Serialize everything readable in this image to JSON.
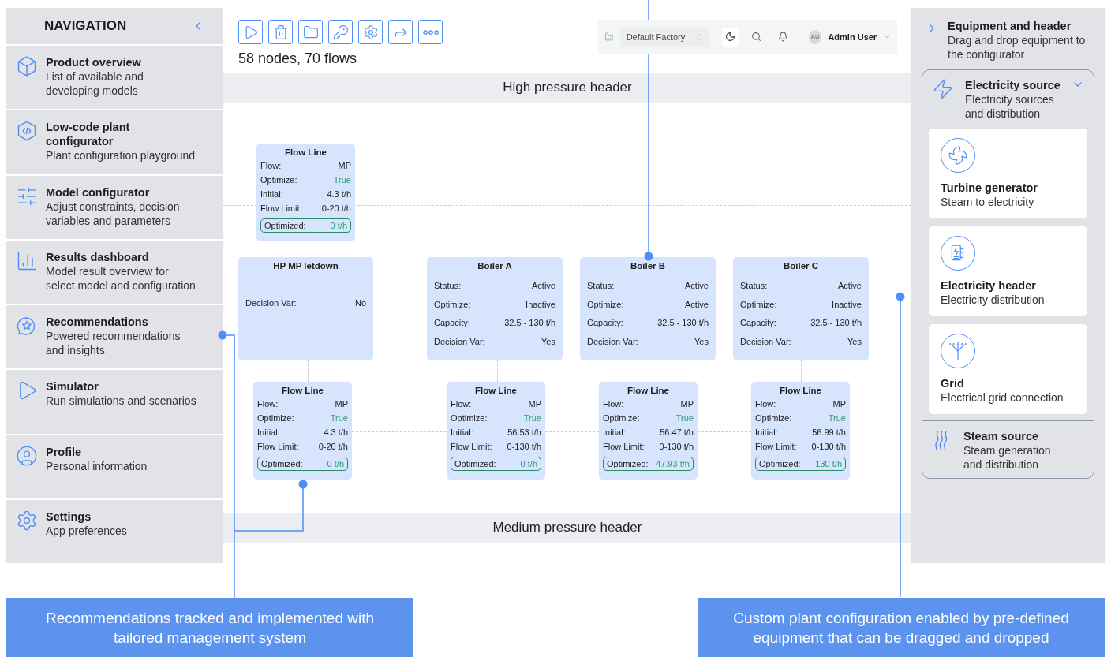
{
  "navigation": {
    "title": "NAVIGATION",
    "items": [
      {
        "title": "Product overview",
        "description": "List of available and developing models"
      },
      {
        "title": "Low-code plant configurator",
        "description": "Plant configuration playground"
      },
      {
        "title": "Model configurator",
        "description": "Adjust constraints, decision variables and parameters"
      },
      {
        "title": "Results dashboard",
        "description": "Model result overview for select model and configuration"
      },
      {
        "title": "Recommendations",
        "description": "Powered recommendations and insights"
      },
      {
        "title": "Simulator",
        "description": "Run simulations and scenarios"
      },
      {
        "title": "Profile",
        "description": "Personal information"
      },
      {
        "title": "Settings",
        "description": "App preferences"
      }
    ]
  },
  "toolbar": {
    "summary": "58 nodes, 70 flows"
  },
  "app_header": {
    "factory": "Default Factory",
    "avatar": "AU",
    "user": "Admin User"
  },
  "canvas": {
    "headers": [
      "High pressure header",
      "Medium pressure header"
    ],
    "nodes": [
      {
        "kind": "flow_line",
        "title": "Flow Line",
        "fields": [
          {
            "label": "Flow:",
            "value": "MP",
            "accent": false
          },
          {
            "label": "Optimize:",
            "value": "True",
            "accent": true
          },
          {
            "label": "Initial:",
            "value": "4.3 t/h",
            "accent": false
          },
          {
            "label": "Flow Limit:",
            "value": "0-20 t/h",
            "accent": false
          }
        ],
        "result": {
          "label": "Optimized:",
          "value": "0 t/h"
        }
      },
      {
        "kind": "equipment",
        "title": "HP MP letdown",
        "fields": [
          {
            "label": "Decision Var:",
            "value": "No",
            "accent": false
          }
        ]
      },
      {
        "kind": "equipment",
        "title": "Boiler A",
        "fields": [
          {
            "label": "Status:",
            "value": "Active",
            "accent": false
          },
          {
            "label": "Optimize:",
            "value": "Inactive",
            "accent": false
          },
          {
            "label": "Capacity:",
            "value": "32.5 - 130 t/h",
            "accent": false
          },
          {
            "label": "Decision Var:",
            "value": "Yes",
            "accent": false
          }
        ]
      },
      {
        "kind": "equipment",
        "title": "Boiler B",
        "fields": [
          {
            "label": "Status:",
            "value": "Active",
            "accent": false
          },
          {
            "label": "Optimize:",
            "value": "Active",
            "accent": false
          },
          {
            "label": "Capacity:",
            "value": "32.5 - 130 t/h",
            "accent": false
          },
          {
            "label": "Decision Var:",
            "value": "Yes",
            "accent": false
          }
        ]
      },
      {
        "kind": "equipment",
        "title": "Boiler C",
        "fields": [
          {
            "label": "Status:",
            "value": "Active",
            "accent": false
          },
          {
            "label": "Optimize:",
            "value": "Inactive",
            "accent": false
          },
          {
            "label": "Capacity:",
            "value": "32.5 - 130 t/h",
            "accent": false
          },
          {
            "label": "Decision Var:",
            "value": "Yes",
            "accent": false
          }
        ]
      },
      {
        "kind": "flow_line",
        "title": "Flow Line",
        "fields": [
          {
            "label": "Flow:",
            "value": "MP",
            "accent": false
          },
          {
            "label": "Optimize:",
            "value": "True",
            "accent": true
          },
          {
            "label": "Initial:",
            "value": "4.3 t/h",
            "accent": false
          },
          {
            "label": "Flow Limit:",
            "value": "0-20 t/h",
            "accent": false
          }
        ],
        "result": {
          "label": "Optimized:",
          "value": "0 t/h"
        }
      },
      {
        "kind": "flow_line",
        "title": "Flow Line",
        "fields": [
          {
            "label": "Flow:",
            "value": "MP",
            "accent": false
          },
          {
            "label": "Optimize:",
            "value": "True",
            "accent": true
          },
          {
            "label": "Initial:",
            "value": "56.53 t/h",
            "accent": false
          },
          {
            "label": "Flow Limit:",
            "value": "0-130 t/h",
            "accent": false
          }
        ],
        "result": {
          "label": "Optimized:",
          "value": "0 t/h"
        }
      },
      {
        "kind": "flow_line",
        "title": "Flow Line",
        "fields": [
          {
            "label": "Flow:",
            "value": "MP",
            "accent": false
          },
          {
            "label": "Optimize:",
            "value": "True",
            "accent": true
          },
          {
            "label": "Initial:",
            "value": "56.47 t/h",
            "accent": false
          },
          {
            "label": "Flow Limit:",
            "value": "0-130 t/h",
            "accent": false
          }
        ],
        "result": {
          "label": "Optimized:",
          "value": "47.93 t/h"
        }
      },
      {
        "kind": "flow_line",
        "title": "Flow Line",
        "fields": [
          {
            "label": "Flow:",
            "value": "MP",
            "accent": false
          },
          {
            "label": "Optimize:",
            "value": "True",
            "accent": true
          },
          {
            "label": "Initial:",
            "value": "56.99 t/h",
            "accent": false
          },
          {
            "label": "Flow Limit:",
            "value": "0-130 t/h",
            "accent": false
          }
        ],
        "result": {
          "label": "Optimized:",
          "value": "130 t/h"
        }
      }
    ]
  },
  "equipment_panel": {
    "title": "Equipment and header",
    "description": "Drag and drop equipment to the configurator",
    "groups": [
      {
        "title": "Electricity source",
        "description": "Electricity sources and distribution",
        "expanded": true,
        "items": [
          {
            "name": "Turbine generator",
            "description": "Steam to electricity"
          },
          {
            "name": "Electricity header",
            "description": "Electricity distribution"
          },
          {
            "name": "Grid",
            "description": "Electrical grid connection"
          }
        ]
      },
      {
        "title": "Steam source",
        "description": "Steam generation and distribution",
        "expanded": false
      }
    ]
  },
  "callouts": [
    "Recommendations tracked and implemented with tailored management system",
    "Custom plant configuration enabled by pre-defined equipment that can be dragged and dropped"
  ]
}
